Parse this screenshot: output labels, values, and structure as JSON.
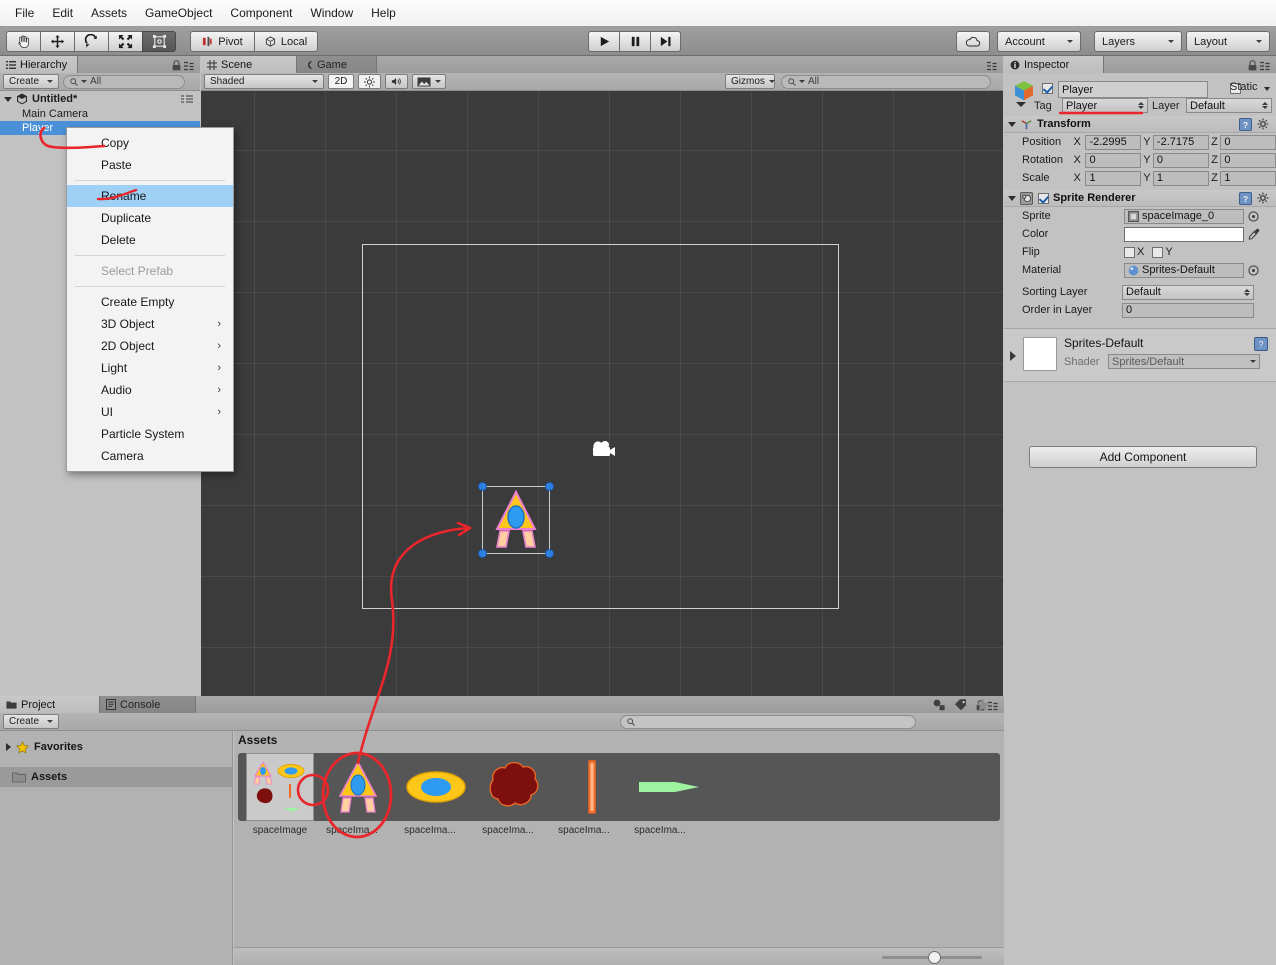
{
  "menubar": {
    "items": [
      "File",
      "Edit",
      "Assets",
      "GameObject",
      "Component",
      "Window",
      "Help"
    ]
  },
  "toolbar": {
    "tools": [
      {
        "name": "hand-tool",
        "glyph": "✋"
      },
      {
        "name": "move-tool",
        "glyph": "✥"
      },
      {
        "name": "rotate-tool",
        "glyph": "⟳"
      },
      {
        "name": "scale-tool",
        "glyph": "⤢"
      },
      {
        "name": "rect-tool",
        "glyph": "▣"
      }
    ],
    "pivot_label": "Pivot",
    "local_label": "Local",
    "play_label": "▶",
    "pause_label": "❙❙",
    "step_label": "▶❙",
    "cloud_label": "☁",
    "account_label": "Account",
    "layers_label": "Layers",
    "layout_label": "Layout"
  },
  "hierarchy": {
    "tab_label": "Hierarchy",
    "create_label": "Create",
    "search_placeholder": "All",
    "scene_name": "Untitled*",
    "items": [
      {
        "label": "Main Camera",
        "selected": false
      },
      {
        "label": "Player",
        "selected": true
      }
    ]
  },
  "context_menu": {
    "items": [
      {
        "label": "Copy",
        "type": "item"
      },
      {
        "label": "Paste",
        "type": "item"
      },
      {
        "label": "",
        "type": "divider"
      },
      {
        "label": "Rename",
        "type": "item",
        "highlighted": true
      },
      {
        "label": "Duplicate",
        "type": "item"
      },
      {
        "label": "Delete",
        "type": "item"
      },
      {
        "label": "",
        "type": "divider"
      },
      {
        "label": "Select Prefab",
        "type": "item",
        "disabled": true
      },
      {
        "label": "",
        "type": "divider"
      },
      {
        "label": "Create Empty",
        "type": "item"
      },
      {
        "label": "3D Object",
        "type": "item",
        "submenu": true
      },
      {
        "label": "2D Object",
        "type": "item",
        "submenu": true
      },
      {
        "label": "Light",
        "type": "item",
        "submenu": true
      },
      {
        "label": "Audio",
        "type": "item",
        "submenu": true
      },
      {
        "label": "UI",
        "type": "item",
        "submenu": true
      },
      {
        "label": "Particle System",
        "type": "item"
      },
      {
        "label": "Camera",
        "type": "item"
      }
    ],
    "submenu_glyph": "›"
  },
  "scene": {
    "tabs": [
      {
        "label": "Scene",
        "active": true,
        "icon": "grid-icon"
      },
      {
        "label": "Game",
        "active": false,
        "icon": "gamepad-icon"
      }
    ],
    "shading_mode": "Shaded",
    "mode_2d": "2D",
    "lighting_icon": "☀",
    "audio_icon": "🔈",
    "effects_icon": "🖼",
    "gizmos_label": "Gizmos",
    "search_placeholder": "All"
  },
  "inspector": {
    "tab_label": "Inspector",
    "object_name": "Player",
    "object_enabled": true,
    "static_label": "Static",
    "static_checked": false,
    "tag_label": "Tag",
    "tag_value": "Player",
    "layer_label": "Layer",
    "layer_value": "Default",
    "transform": {
      "title": "Transform",
      "enabled": true,
      "rows": [
        {
          "label": "Position",
          "x": "-2.2995",
          "y": "-2.7175",
          "z": "0"
        },
        {
          "label": "Rotation",
          "x": "0",
          "y": "0",
          "z": "0"
        },
        {
          "label": "Scale",
          "x": "1",
          "y": "1",
          "z": "1"
        }
      ],
      "axis_labels": [
        "X",
        "Y",
        "Z"
      ]
    },
    "sprite_renderer": {
      "title": "Sprite Renderer",
      "enabled": true,
      "sprite_label": "Sprite",
      "sprite_value": "spaceImage_0",
      "color_label": "Color",
      "color_value": "#ffffff",
      "flip_label": "Flip",
      "flip_x_label": "X",
      "flip_y_label": "Y",
      "flip_x": false,
      "flip_y": false,
      "material_label": "Material",
      "material_value": "Sprites-Default",
      "sorting_layer_label": "Sorting Layer",
      "sorting_layer_value": "Default",
      "order_in_layer_label": "Order in Layer",
      "order_in_layer_value": "0"
    },
    "material_preview": {
      "name": "Sprites-Default",
      "shader_label": "Shader",
      "shader_value": "Sprites/Default"
    },
    "add_component_label": "Add Component"
  },
  "project": {
    "tabs": [
      {
        "label": "Project",
        "active": true,
        "icon": "folder-icon"
      },
      {
        "label": "Console",
        "active": false,
        "icon": "console-icon"
      }
    ],
    "create_label": "Create",
    "search_placeholder": "",
    "favorites_label": "Favorites",
    "assets_tree_label": "Assets",
    "breadcrumb": "Assets",
    "assets": [
      {
        "label": "spaceImage",
        "kind": "sheet",
        "selected": true
      },
      {
        "label": "spaceIma...",
        "kind": "ship",
        "selected": false
      },
      {
        "label": "spaceIma...",
        "kind": "oval",
        "selected": false
      },
      {
        "label": "spaceIma...",
        "kind": "blob",
        "selected": false
      },
      {
        "label": "spaceIma...",
        "kind": "bar",
        "selected": false
      },
      {
        "label": "spaceIma...",
        "kind": "arrow",
        "selected": false
      }
    ]
  },
  "colors": {
    "accent_blue": "#4a90d9",
    "menu_highlight": "#9fd0f5",
    "annotation_red": "#e8262b",
    "sprite_yellow": "#ffc61a",
    "sprite_blue": "#2e9bf0",
    "sprite_pink": "#ef7fd0",
    "sprite_peach": "#ffcfa0",
    "blob_red": "#7d0f0f",
    "arrow_green": "#9ff2a0",
    "bar_orange": "#f26a22",
    "scene_bg": "#3b3b3b",
    "panel_bg": "#c2c2c2"
  }
}
